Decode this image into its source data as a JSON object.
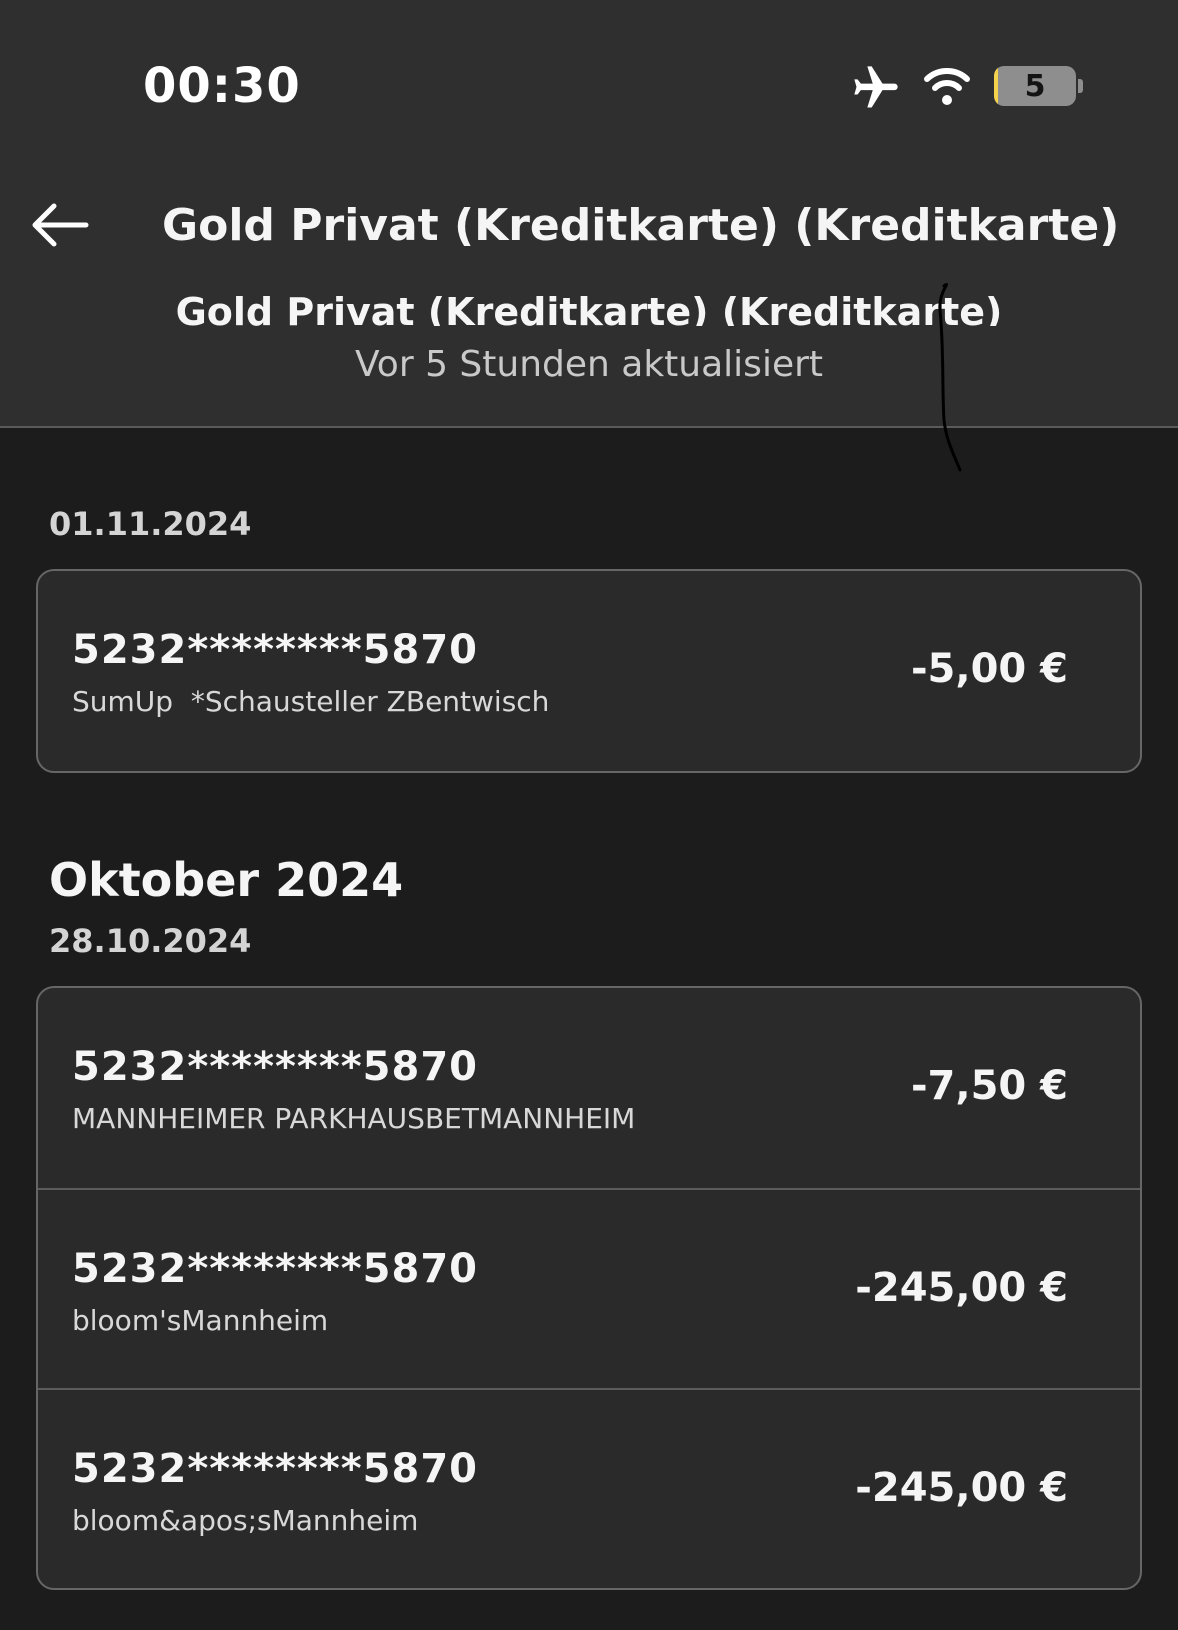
{
  "status_bar": {
    "time": "00:30",
    "battery_level": "5",
    "icons": [
      "airplane-icon",
      "wifi-icon",
      "battery-icon"
    ],
    "battery_fill_fraction": 0.05
  },
  "header": {
    "title": "Gold Privat (Kreditkarte) (Kreditkarte)",
    "sub_title": "Gold Privat (Kreditkarte) (Kreditkarte)",
    "updated": "Vor 5 Stunden aktualisiert",
    "back_icon": "arrow-left-icon"
  },
  "groups": [
    {
      "month": "",
      "date": "01.11.2024",
      "transactions": [
        {
          "card": "5232********5870",
          "merchant": "SumUp  *Schausteller ZBentwisch",
          "amount": "-5,00 €"
        }
      ]
    },
    {
      "month": "Oktober 2024",
      "date": "28.10.2024",
      "transactions": [
        {
          "card": "5232********5870",
          "merchant": "MANNHEIMER PARKHAUSBETMANNHEIM",
          "amount": "-7,50 €"
        },
        {
          "card": "5232********5870",
          "merchant": "bloom'sMannheim",
          "amount": "-245,00 €"
        },
        {
          "card": "5232********5870",
          "merchant": "bloom&apos;sMannheim",
          "amount": "-245,00 €"
        }
      ]
    }
  ],
  "colors": {
    "background": "#1c1c1c",
    "header": "#2f2f2f",
    "card": "#2a2a2a",
    "battery_accent": "#f5d24b"
  }
}
